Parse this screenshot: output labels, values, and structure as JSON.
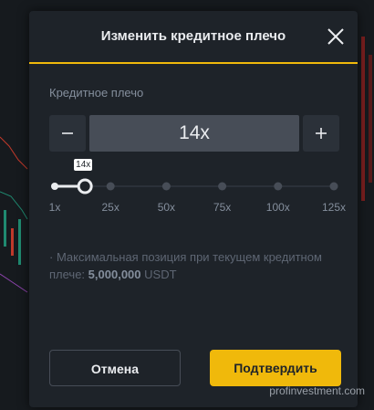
{
  "modal": {
    "title": "Изменить кредитное плечо",
    "field_label": "Кредитное плечо",
    "leverage_value": "14x",
    "tooltip": "14x",
    "slider_marks": [
      "1x",
      "25x",
      "50x",
      "75x",
      "100x",
      "125x"
    ],
    "slider_value": 14,
    "slider_range": [
      1,
      125
    ],
    "info_text": "· Максимальная позиция при текущем кредитном плече:",
    "info_value": "5,000,000",
    "info_unit": "USDT",
    "cancel_label": "Отмена",
    "confirm_label": "Подтвердить"
  },
  "watermark": "profinvestment.com",
  "colors": {
    "accent": "#f0b90b",
    "background": "#1e2329",
    "muted": "#848e9c"
  },
  "icons": {
    "close": "close-icon",
    "minus": "minus-icon",
    "plus": "plus-icon"
  }
}
